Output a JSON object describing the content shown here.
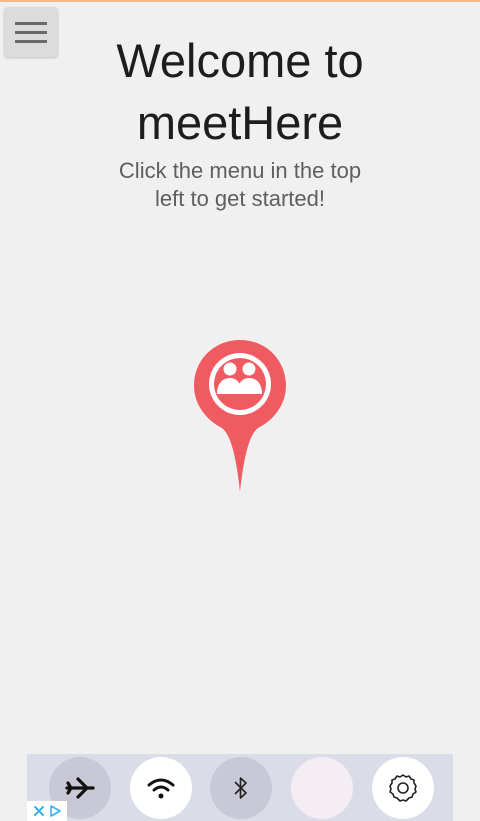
{
  "header": {
    "title_line1": "Welcome to",
    "title_line2": "meetHere",
    "subtitle_line1": "Click the menu in the top",
    "subtitle_line2": "left to get started!"
  },
  "icons": {
    "menu": "hamburger-menu-icon",
    "logo": "map-pin-group-icon",
    "airplane": "airplane-icon",
    "wifi": "wifi-icon",
    "bluetooth": "bluetooth-icon",
    "settings": "gear-icon",
    "ad_close": "close-icon",
    "ad_choices": "adchoices-icon"
  },
  "colors": {
    "accent": "#f05b61",
    "background": "#f0f0f0",
    "ad_background": "#dadde8",
    "adchoices": "#3ab0e2"
  }
}
